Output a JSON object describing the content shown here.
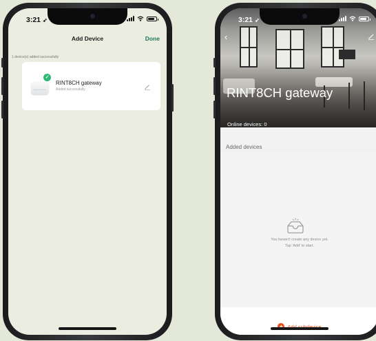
{
  "left_screen": {
    "status_time": "3:21",
    "nav": {
      "title": "Add Device",
      "done_label": "Done"
    },
    "success_note": "1 device(s) added successfully",
    "device": {
      "name": "RINT8CH gateway",
      "status": "Added successfully"
    }
  },
  "right_screen": {
    "status_time": "3:21",
    "gateway_title": "RINT8CH gateway",
    "online_devices": "Online devices: 0",
    "added_devices_label": "Added devices",
    "empty_line1": "You haven't create any device yet.",
    "empty_line2": "Tap 'Add' to start.",
    "add_subdevice_label": "Add subdevice"
  },
  "colors": {
    "background": "#e3e8d9",
    "accent_green": "#1f7a5c",
    "success_green": "#2fb875",
    "accent_orange": "#ea4a14"
  },
  "icons": [
    "location-arrow-icon",
    "signal-icon",
    "wifi-icon",
    "battery-icon",
    "check-icon",
    "edit-pencil-icon",
    "back-chevron-icon",
    "empty-tray-icon",
    "plus-circle-icon"
  ]
}
